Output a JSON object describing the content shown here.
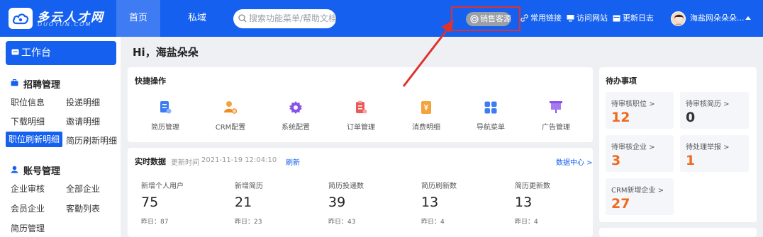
{
  "brand": {
    "name": "多云人才网",
    "sub": "DUOYUN.COM"
  },
  "nav": {
    "home": "首页",
    "private": "私域"
  },
  "search": {
    "placeholder": "搜索功能菜单/帮助文档"
  },
  "header_links": {
    "sales": "销售客源",
    "common_links": "常用链接",
    "visit_site": "访问网站",
    "update_log": "更新日志"
  },
  "user": {
    "name": "海盐网朵朵朵..."
  },
  "sidebar": {
    "workbench": "工作台",
    "groups": [
      {
        "title": "招聘管理",
        "items": [
          "职位信息",
          "投递明细",
          "下载明细",
          "邀请明细",
          "职位刷新明细",
          "简历刷新明细"
        ],
        "active_index": 4
      },
      {
        "title": "账号管理",
        "items": [
          "企业审核",
          "全部企业",
          "会员企业",
          "客勤列表",
          "简历管理"
        ]
      }
    ]
  },
  "greeting": "Hi，海盐朵朵",
  "quick_actions": {
    "title": "快捷操作",
    "items": [
      {
        "label": "简历管理",
        "icon": "resume-icon"
      },
      {
        "label": "CRM配置",
        "icon": "crm-config-icon"
      },
      {
        "label": "系统配置",
        "icon": "system-config-icon"
      },
      {
        "label": "订单管理",
        "icon": "order-icon"
      },
      {
        "label": "消费明细",
        "icon": "consume-icon"
      },
      {
        "label": "导航菜单",
        "icon": "nav-menu-icon"
      },
      {
        "label": "广告管理",
        "icon": "ad-icon"
      }
    ]
  },
  "realtime": {
    "title": "实时数据",
    "updated_label": "更新时间",
    "updated_time": "2021-11-19 12:04:10",
    "refresh": "刷新",
    "data_center": "数据中心 >",
    "stats": [
      {
        "label": "新增个人用户",
        "value": "75",
        "yesterday": "昨日：87"
      },
      {
        "label": "新增简历",
        "value": "21",
        "yesterday": "昨日：23"
      },
      {
        "label": "简历投递数",
        "value": "39",
        "yesterday": "昨日：43"
      },
      {
        "label": "简历刷新数",
        "value": "13",
        "yesterday": "昨日：4"
      },
      {
        "label": "简历更新数",
        "value": "13",
        "yesterday": "昨日：4"
      }
    ]
  },
  "todo": {
    "title": "待办事项",
    "items": [
      {
        "label": "待审核职位 >",
        "value": "12",
        "color": "#f06a1d"
      },
      {
        "label": "待审核简历 >",
        "value": "0",
        "color": "#333333"
      },
      {
        "label": "待审核企业 >",
        "value": "3",
        "color": "#f06a1d"
      },
      {
        "label": "待处理举报 >",
        "value": "1",
        "color": "#f06a1d"
      },
      {
        "label": "CRM新增企业 >",
        "value": "27",
        "color": "#f06a1d"
      }
    ]
  },
  "colors": {
    "primary": "#1560ee",
    "highlight": "#e0312c",
    "accent": "#f06a1d"
  }
}
